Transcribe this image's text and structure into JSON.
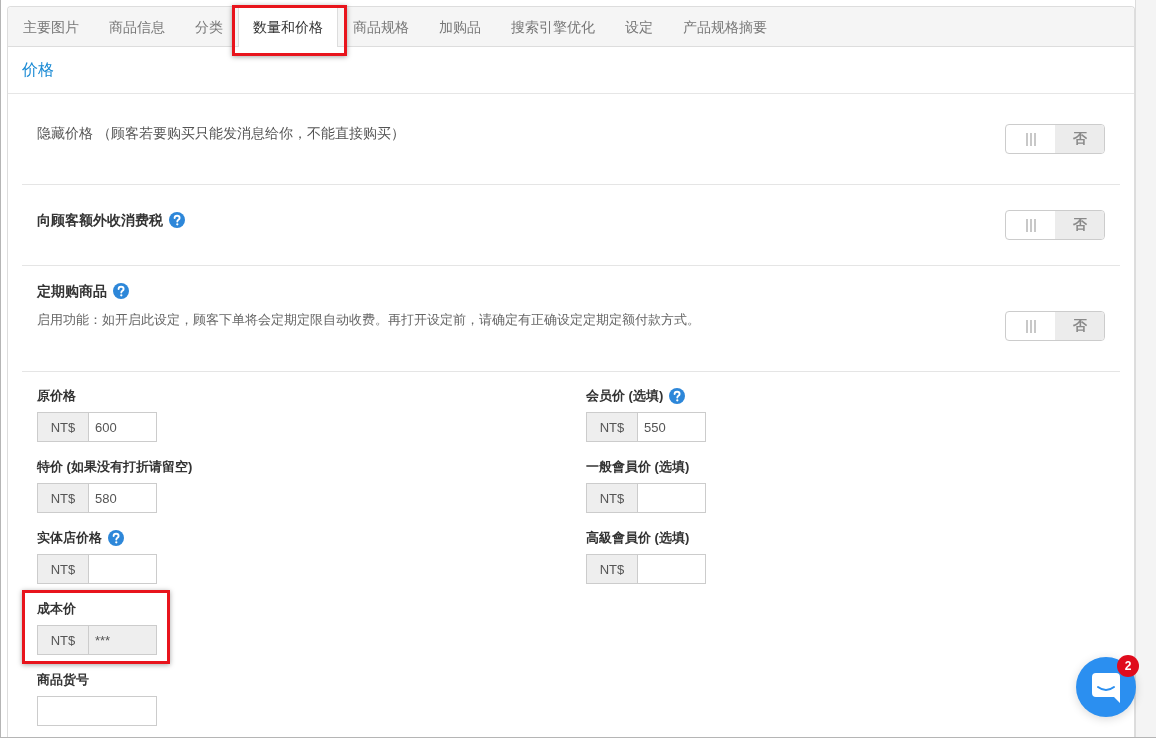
{
  "tabs": [
    {
      "label": "主要图片",
      "selected": false,
      "highlighted": false
    },
    {
      "label": "商品信息",
      "selected": false,
      "highlighted": false
    },
    {
      "label": "分类",
      "selected": false,
      "highlighted": false
    },
    {
      "label": "数量和价格",
      "selected": true,
      "highlighted": true
    },
    {
      "label": "商品规格",
      "selected": false,
      "highlighted": false
    },
    {
      "label": "加购品",
      "selected": false,
      "highlighted": false
    },
    {
      "label": "搜索引擎优化",
      "selected": false,
      "highlighted": false
    },
    {
      "label": "设定",
      "selected": false,
      "highlighted": false
    },
    {
      "label": "产品规格摘要",
      "selected": false,
      "highlighted": false
    }
  ],
  "section": {
    "title": "价格"
  },
  "settings": [
    {
      "kind": "plain",
      "label": "隐藏价格 （顾客若要购买只能发消息给你，不能直接购买）",
      "help": false,
      "toggle": {
        "on": false,
        "off_label": "否"
      }
    },
    {
      "kind": "titled",
      "label": "向顾客额外收消费税",
      "help": true,
      "toggle": {
        "on": false,
        "off_label": "否"
      }
    },
    {
      "kind": "titled",
      "label": "定期购商品",
      "help": true,
      "description": "启用功能：如开启此设定，顾客下单将会定期定限自动收费。再打开设定前，请确定有正确设定定期定额付款方式。",
      "toggle": {
        "on": false,
        "off_label": "否"
      }
    }
  ],
  "price_fields": {
    "left": [
      {
        "label": "原价格",
        "help": false,
        "prefix": "NT$",
        "value": "600",
        "disabled": false,
        "highlighted": false
      },
      {
        "label": "特价 (如果没有打折请留空)",
        "help": false,
        "prefix": "NT$",
        "value": "580",
        "disabled": false,
        "highlighted": false
      },
      {
        "label": "实体店价格",
        "help": true,
        "prefix": "NT$",
        "disabled": false,
        "highlighted": false
      },
      {
        "label": "成本价",
        "help": false,
        "prefix": "NT$",
        "value": "***",
        "disabled": true,
        "highlighted": true
      },
      {
        "label": "商品货号",
        "help": false,
        "disabled": false,
        "highlighted": false
      }
    ],
    "right": [
      {
        "label": "会员价 (选填)",
        "help": true,
        "prefix": "NT$",
        "value": "550",
        "disabled": false,
        "highlighted": false
      },
      {
        "label": "一般會員价 (选填)",
        "help": false,
        "prefix": "NT$",
        "disabled": false,
        "highlighted": false
      },
      {
        "label": "高級會員价 (选填)",
        "help": false,
        "prefix": "NT$",
        "disabled": false,
        "highlighted": false
      }
    ]
  },
  "chat_button": {
    "badge": "2"
  }
}
